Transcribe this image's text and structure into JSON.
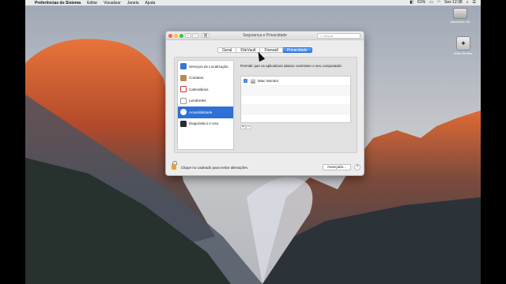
{
  "menubar": {
    "app_name": "Preferências do Sistema",
    "items": [
      "Editar",
      "Visualizar",
      "Janela",
      "Ajuda"
    ],
    "battery_percent": "61%",
    "clock": "Sex 12:38"
  },
  "desktop_icons": {
    "hd_label": "Macintosh HD",
    "app_label": "iMac Monitor"
  },
  "window": {
    "title": "Segurança e Privacidade",
    "search_placeholder": "Buscar",
    "tabs": [
      {
        "label": "Geral",
        "active": false
      },
      {
        "label": "FileVault",
        "active": false
      },
      {
        "label": "Firewall",
        "active": false
      },
      {
        "label": "Privacidade",
        "active": true
      }
    ],
    "sidebar": [
      {
        "label": "Serviços de Localização",
        "icon": "location-icon"
      },
      {
        "label": "Contatos",
        "icon": "contacts-icon"
      },
      {
        "label": "Calendários",
        "icon": "calendar-icon"
      },
      {
        "label": "Lembretes",
        "icon": "reminders-icon"
      },
      {
        "label": "Acessibilidade",
        "icon": "accessibility-icon",
        "selected": true
      },
      {
        "label": "Diagnóstico e Uso",
        "icon": "diagnostics-icon"
      }
    ],
    "allow_text": "Permitir que os aplicativos abaixo controlem o seu computador.",
    "apps": [
      {
        "name": "iMac Monitor",
        "checked": true
      }
    ],
    "plus": "+",
    "minus": "−",
    "lock_text": "Clique no cadeado para evitar alterações.",
    "advanced_button": "Avançado...",
    "help": "?"
  }
}
